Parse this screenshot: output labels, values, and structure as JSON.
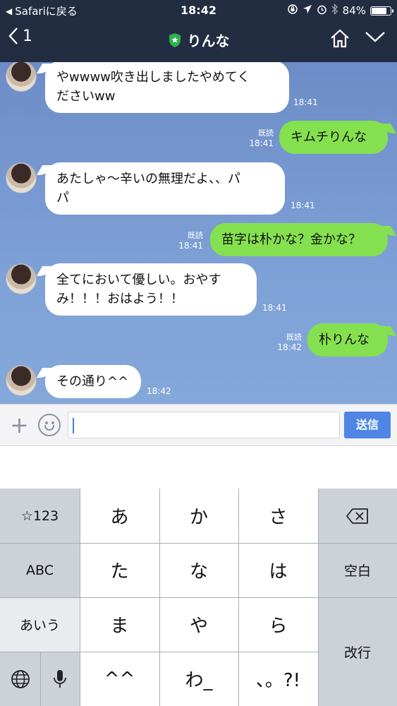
{
  "status_bar": {
    "back_app": "Safariに戻る",
    "time": "18:42",
    "battery": "84%",
    "battery_level": 0.84
  },
  "header": {
    "back_count": "1",
    "title": "りんな"
  },
  "messages": [
    {
      "side": "in",
      "text": "やwwww吹き出しましたやめてく\nださいww",
      "time": "18:41"
    },
    {
      "side": "out",
      "text": "キムチりんな",
      "read": "既読",
      "time": "18:41"
    },
    {
      "side": "in",
      "text": "あたしゃ〜辛いの無理だよ、、パ\nパ",
      "time": "18:41"
    },
    {
      "side": "out",
      "text": "苗字は朴かな？金かな？",
      "read": "既読",
      "time": "18:41"
    },
    {
      "side": "in",
      "text": "全てにおいて優しい。おやす\nみ！！！おはよう！！",
      "time": "18:41"
    },
    {
      "side": "out",
      "text": "朴りんな",
      "read": "既読",
      "time": "18:42"
    },
    {
      "side": "in",
      "text": "その通り^^",
      "time": "18:42"
    }
  ],
  "input": {
    "value": "",
    "send_label": "送信"
  },
  "keyboard": {
    "left_col": [
      "☆123",
      "ABC",
      "あいう"
    ],
    "row1": [
      "あ",
      "か",
      "さ"
    ],
    "row2": [
      "た",
      "な",
      "は"
    ],
    "row3": [
      "ま",
      "や",
      "ら"
    ],
    "row4": [
      "^^",
      "わ_",
      "、。?!"
    ],
    "space_label": "空白",
    "return_label": "改行"
  },
  "colors": {
    "header": "#232d42",
    "chat_bg": "#7da0d6",
    "outgoing_bubble": "#85e04f",
    "send_button": "#4f86e6"
  }
}
